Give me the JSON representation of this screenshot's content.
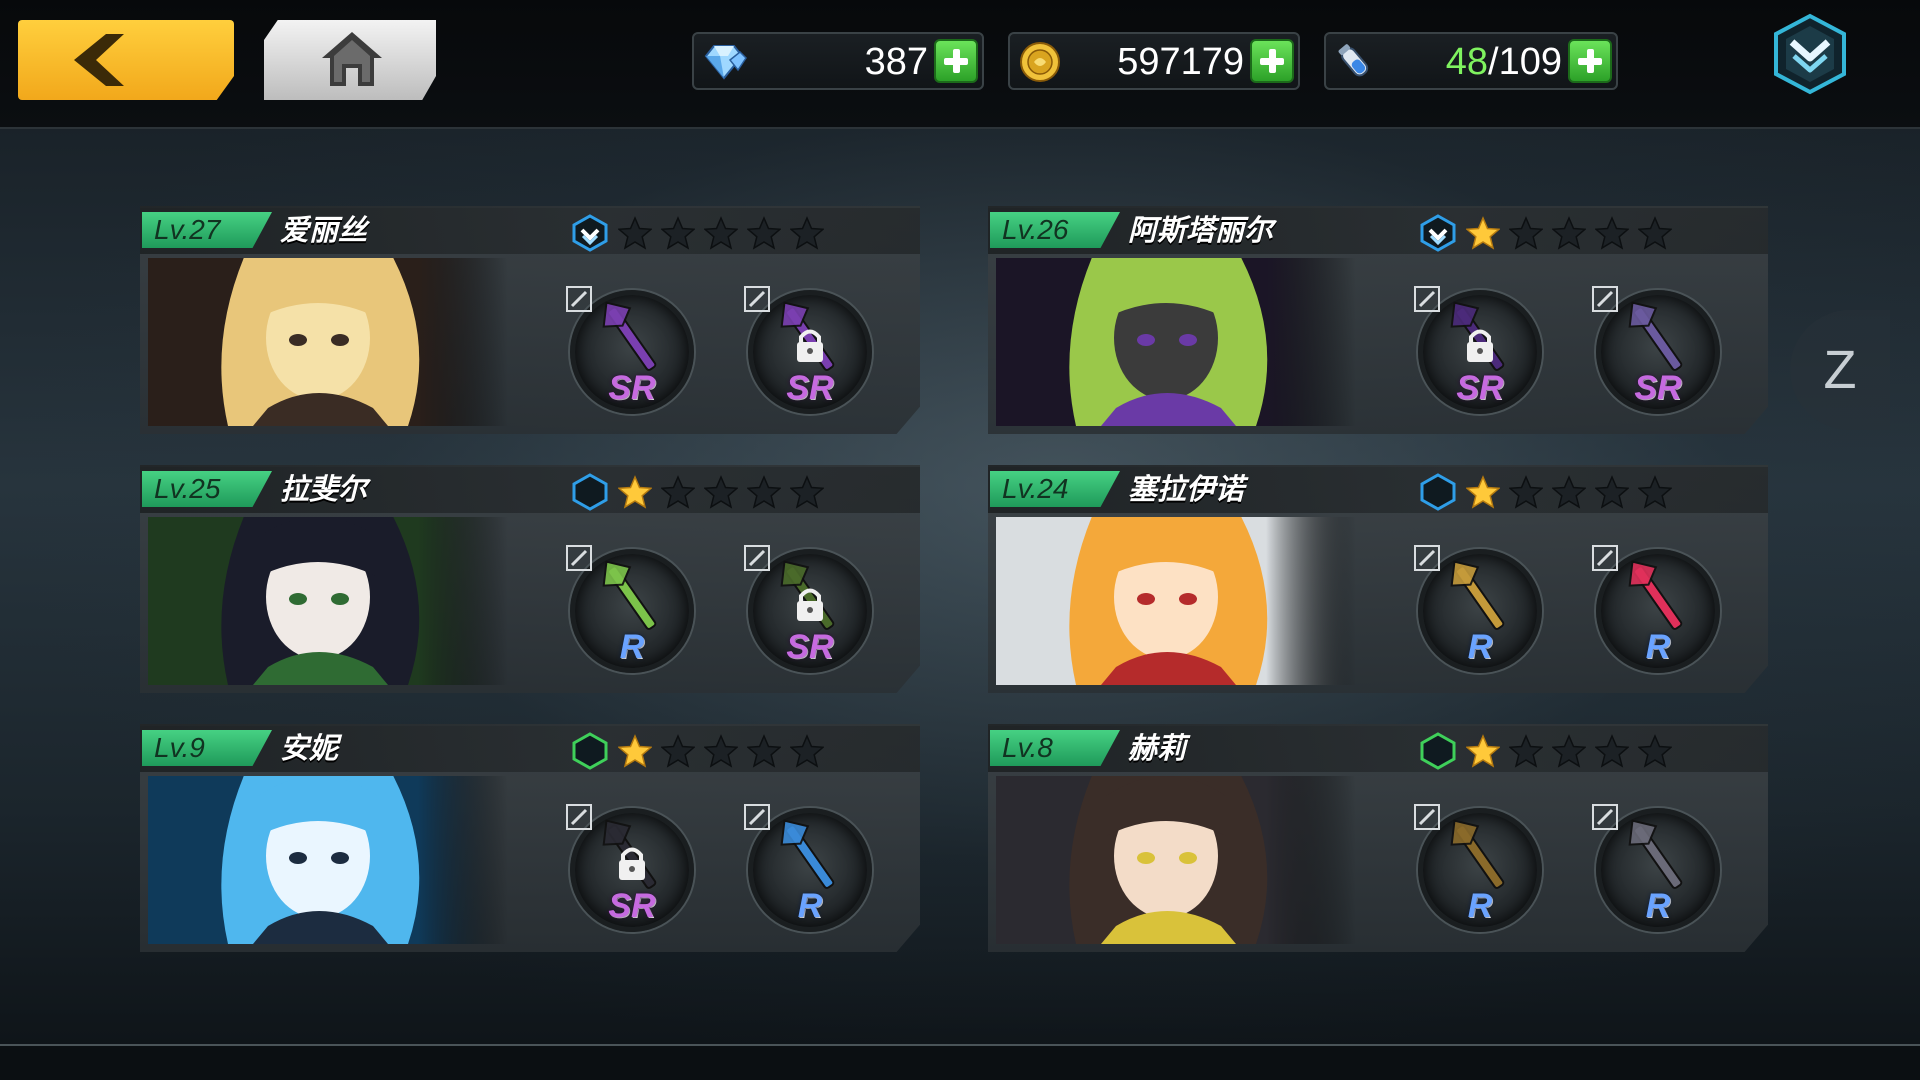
{
  "nav": {
    "back_icon": "back-arrow-icon",
    "home_icon": "home-icon"
  },
  "resources": {
    "diamonds": {
      "icon": "diamond-icon",
      "value": "387"
    },
    "gold": {
      "icon": "gold-coin-icon",
      "value": "597179"
    },
    "stamina": {
      "icon": "stamina-vial-icon",
      "current": "48",
      "separator": "/",
      "max": "109"
    }
  },
  "menu": {
    "icon": "dropdown-menu-icon"
  },
  "side_tab": {
    "label": "Z"
  },
  "colors": {
    "level_badge": "#2fb26b",
    "star_filled": "#ffc93a",
    "star_empty": "#1c2125",
    "hex_blue": "#2f9ee8",
    "hex_green": "#3fd05a",
    "rarity_sr": "#c66ae0",
    "rarity_r": "#6aa3ff",
    "plus_green": "#3fbf35"
  },
  "characters": [
    {
      "level": "Lv.27",
      "name": "爱丽丝",
      "badge": "blue-chevron",
      "stars": 0,
      "weapons": [
        {
          "rarity": "SR",
          "locked": false,
          "icon": "scythe-icon"
        },
        {
          "rarity": "SR",
          "locked": true,
          "icon": "scythe-icon"
        }
      ]
    },
    {
      "level": "Lv.26",
      "name": "阿斯塔丽尔",
      "badge": "blue-chevron",
      "stars": 1,
      "weapons": [
        {
          "rarity": "SR",
          "locked": true,
          "icon": "crossbow-icon"
        },
        {
          "rarity": "SR",
          "locked": false,
          "icon": "spear-icon"
        }
      ]
    },
    {
      "level": "Lv.25",
      "name": "拉斐尔",
      "badge": "blue-hex",
      "stars": 1,
      "weapons": [
        {
          "rarity": "R",
          "locked": false,
          "icon": "flower-wand-icon"
        },
        {
          "rarity": "SR",
          "locked": true,
          "icon": "thorn-ring-icon"
        }
      ]
    },
    {
      "level": "Lv.24",
      "name": "塞拉伊诺",
      "badge": "blue-hex",
      "stars": 1,
      "weapons": [
        {
          "rarity": "R",
          "locked": false,
          "icon": "anchor-sword-icon"
        },
        {
          "rarity": "R",
          "locked": false,
          "icon": "red-blade-icon"
        }
      ]
    },
    {
      "level": "Lv.9",
      "name": "安妮",
      "badge": "green-hex",
      "stars": 1,
      "weapons": [
        {
          "rarity": "SR",
          "locked": true,
          "icon": "camera-icon"
        },
        {
          "rarity": "R",
          "locked": false,
          "icon": "cat-staff-icon"
        }
      ]
    },
    {
      "level": "Lv.8",
      "name": "赫莉",
      "badge": "green-hex",
      "stars": 1,
      "weapons": [
        {
          "rarity": "R",
          "locked": false,
          "icon": "rifle-icon"
        },
        {
          "rarity": "R",
          "locked": false,
          "icon": "cannon-icon"
        }
      ]
    }
  ]
}
